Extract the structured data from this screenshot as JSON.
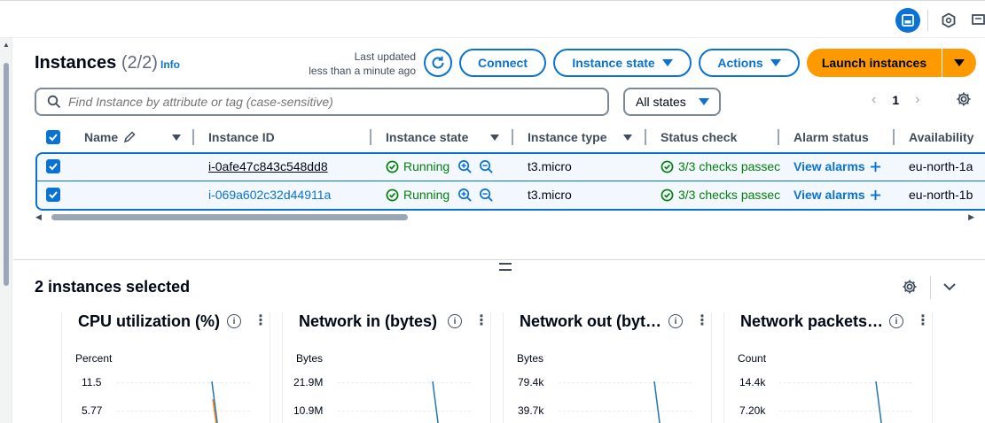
{
  "header": {
    "title": "Instances",
    "count": "(2/2)",
    "info": "Info",
    "last_updated_line1": "Last updated",
    "last_updated_line2": "less than a minute ago"
  },
  "toolbar": {
    "connect": "Connect",
    "instance_state": "Instance state",
    "actions": "Actions",
    "launch": "Launch instances"
  },
  "filter": {
    "placeholder": "Find Instance by attribute or tag (case-sensitive)",
    "states_selected": "All states"
  },
  "pagination": {
    "current_page": "1"
  },
  "table": {
    "columns": [
      "Name",
      "Instance ID",
      "Instance state",
      "Instance type",
      "Status check",
      "Alarm status",
      "Availability"
    ],
    "rows": [
      {
        "name": "",
        "id": "i-0afe47c843c548dd8",
        "state": "Running",
        "type": "t3.micro",
        "status": "3/3 checks passec",
        "alarm": "View alarms",
        "az": "eu-north-1a"
      },
      {
        "name": "",
        "id": "i-069a602c32d44911a",
        "state": "Running",
        "type": "t3.micro",
        "status": "3/3 checks passec",
        "alarm": "View alarms",
        "az": "eu-north-1b"
      }
    ]
  },
  "details": {
    "selected_title": "2 instances selected"
  },
  "metrics": [
    {
      "title": "CPU utilization (%)",
      "unit": "Percent",
      "y1": "11.5",
      "y2": "5.77"
    },
    {
      "title": "Network in (bytes)",
      "unit": "Bytes",
      "y1": "21.9M",
      "y2": "10.9M"
    },
    {
      "title": "Network out (byt…",
      "unit": "Bytes",
      "y1": "79.4k",
      "y2": "39.7k"
    },
    {
      "title": "Network packets…",
      "unit": "Count",
      "y1": "14.4k",
      "y2": "7.20k"
    }
  ],
  "colors": {
    "accent": "#0972d3",
    "primary_button": "#ff9900",
    "success": "#037f0c",
    "series_blue": "#1f77b4",
    "series_orange": "#ff7f0e"
  }
}
